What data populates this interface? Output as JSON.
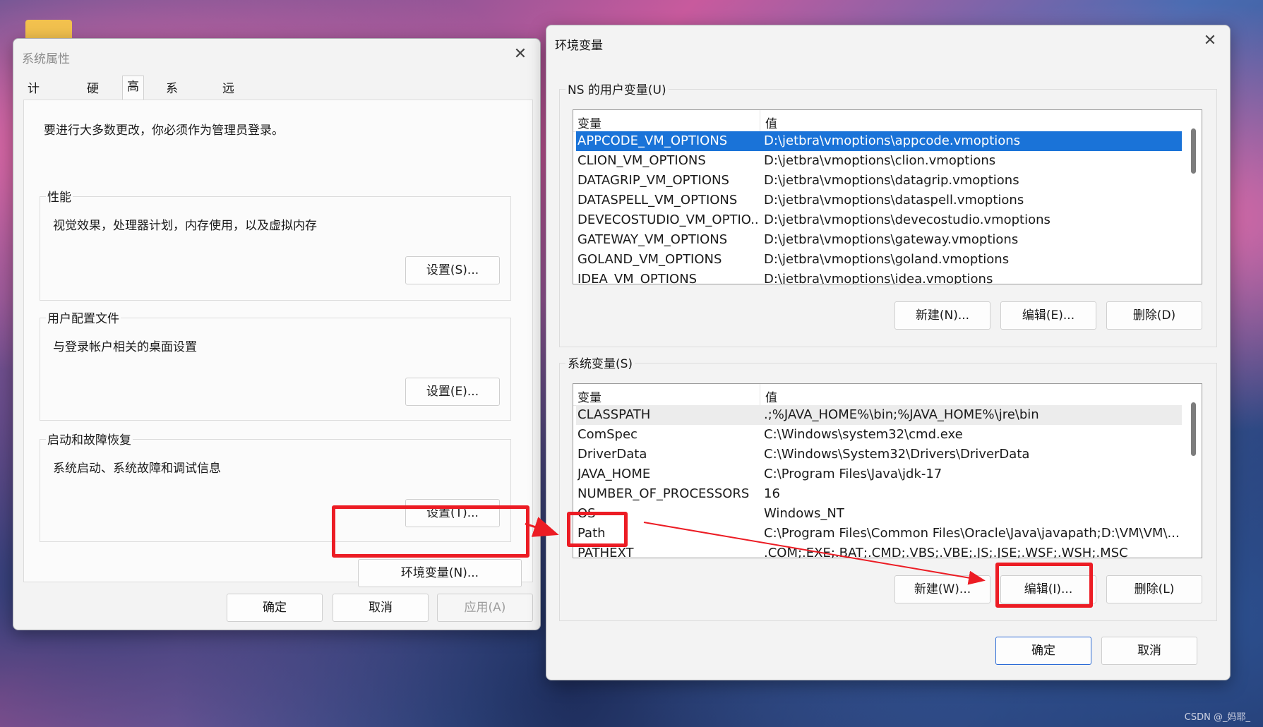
{
  "system_properties": {
    "title": "系统属性",
    "tabs": [
      "计算机名",
      "硬件",
      "高级",
      "系统保护",
      "远程"
    ],
    "admin_note": "要进行大多数更改，你必须作为管理员登录。",
    "performance": {
      "title": "性能",
      "desc": "视觉效果，处理器计划，内存使用，以及虚拟内存",
      "button": "设置(S)..."
    },
    "user_profiles": {
      "title": "用户配置文件",
      "desc": "与登录帐户相关的桌面设置",
      "button": "设置(E)..."
    },
    "startup_recovery": {
      "title": "启动和故障恢复",
      "desc": "系统启动、系统故障和调试信息",
      "button": "设置(T)..."
    },
    "env_button": "环境变量(N)...",
    "ok": "确定",
    "cancel": "取消",
    "apply": "应用(A)"
  },
  "env_vars": {
    "title": "环境变量",
    "user_section": {
      "label": "NS 的用户变量(U)",
      "col_var": "变量",
      "col_val": "值",
      "rows": [
        {
          "name": "APPCODE_VM_OPTIONS",
          "value": "D:\\jetbra\\vmoptions\\appcode.vmoptions"
        },
        {
          "name": "CLION_VM_OPTIONS",
          "value": "D:\\jetbra\\vmoptions\\clion.vmoptions"
        },
        {
          "name": "DATAGRIP_VM_OPTIONS",
          "value": "D:\\jetbra\\vmoptions\\datagrip.vmoptions"
        },
        {
          "name": "DATASPELL_VM_OPTIONS",
          "value": "D:\\jetbra\\vmoptions\\dataspell.vmoptions"
        },
        {
          "name": "DEVECOSTUDIO_VM_OPTIO...",
          "value": "D:\\jetbra\\vmoptions\\devecostudio.vmoptions"
        },
        {
          "name": "GATEWAY_VM_OPTIONS",
          "value": "D:\\jetbra\\vmoptions\\gateway.vmoptions"
        },
        {
          "name": "GOLAND_VM_OPTIONS",
          "value": "D:\\jetbra\\vmoptions\\goland.vmoptions"
        },
        {
          "name": "IDEA_VM_OPTIONS",
          "value": "D:\\jetbra\\vmoptions\\idea.vmoptions"
        }
      ],
      "new": "新建(N)...",
      "edit": "编辑(E)...",
      "delete": "删除(D)"
    },
    "system_section": {
      "label": "系统变量(S)",
      "col_var": "变量",
      "col_val": "值",
      "rows": [
        {
          "name": "CLASSPATH",
          "value": ".;%JAVA_HOME%\\bin;%JAVA_HOME%\\jre\\bin"
        },
        {
          "name": "ComSpec",
          "value": "C:\\Windows\\system32\\cmd.exe"
        },
        {
          "name": "DriverData",
          "value": "C:\\Windows\\System32\\Drivers\\DriverData"
        },
        {
          "name": "JAVA_HOME",
          "value": "C:\\Program Files\\Java\\jdk-17"
        },
        {
          "name": "NUMBER_OF_PROCESSORS",
          "value": "16"
        },
        {
          "name": "OS",
          "value": "Windows_NT"
        },
        {
          "name": "Path",
          "value": "C:\\Program Files\\Common Files\\Oracle\\Java\\javapath;D:\\VM\\VM\\..."
        },
        {
          "name": "PATHEXT",
          "value": ".COM;.EXE;.BAT;.CMD;.VBS;.VBE;.JS;.JSE;.WSF;.WSH;.MSC"
        }
      ],
      "new": "新建(W)...",
      "edit": "编辑(I)...",
      "delete": "删除(L)"
    },
    "ok": "确定",
    "cancel": "取消"
  },
  "watermark": "CSDN @_妈耶_",
  "colors": {
    "highlight": "#ec1c24",
    "selection": "#1a73d8",
    "primary_border": "#2b6ad6"
  }
}
